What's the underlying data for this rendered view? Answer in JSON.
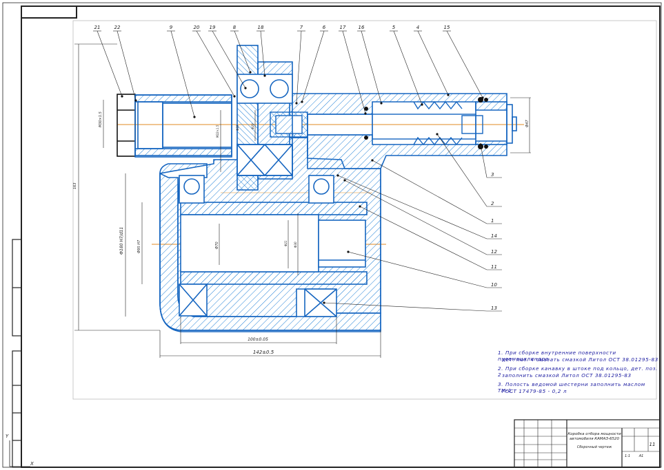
{
  "drawing": {
    "leaders": [
      {
        "label": "21"
      },
      {
        "label": "22"
      },
      {
        "label": "9"
      },
      {
        "label": "20"
      },
      {
        "label": "19"
      },
      {
        "label": "8"
      },
      {
        "label": "18"
      },
      {
        "label": "7"
      },
      {
        "label": "6"
      },
      {
        "label": "17"
      },
      {
        "label": "16"
      },
      {
        "label": "5"
      },
      {
        "label": "4"
      },
      {
        "label": "15"
      }
    ],
    "right_leaders": [
      {
        "label": "3"
      },
      {
        "label": "2"
      },
      {
        "label": "1"
      },
      {
        "label": "14"
      },
      {
        "label": "12"
      },
      {
        "label": "11"
      },
      {
        "label": "10"
      },
      {
        "label": "13"
      }
    ],
    "dimensions": {
      "d1": "142±0.5",
      "d2": "100±0.05",
      "v1": "163",
      "v2": "Ф180 Н7/d11",
      "v3": "Ф95 Н7",
      "v4": "Ф70",
      "v5": "M30×1.5",
      "v6": "M22×1.5",
      "v7": "Ф20",
      "v8": "Ф21",
      "v9": "Ф30",
      "v10": "Ф47",
      "v11": "Ф29"
    },
    "notes": [
      "1. При сборке внутренние поверхности пневмоцилиндра",
      "дет. поз. 4 смазать смазкой Литол ОСТ 38.01295-83",
      "2. При сборке канавку в штоке под кольцо, дет. поз. 2",
      "заполнить смазкой Литол ОСТ 38.01295-83",
      "3. Полость ведомой шестерни заполнить маслом ТМ-1,",
      "ГОСТ 17479-85 - 0,2 л"
    ]
  },
  "title_block": {
    "title_line1": "Коробка отбора мощности",
    "title_line2": "автомобиля КАМАЗ-6520",
    "subtitle": "Сборочный чертеж",
    "sheet": "1:1",
    "format": "А1",
    "sheet_count": "11"
  },
  "axes": {
    "x": "X",
    "y": "Y"
  }
}
